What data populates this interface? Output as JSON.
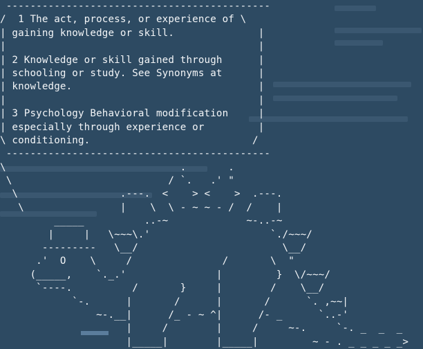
{
  "terminal": {
    "lines": [
      " -------------------------------------------- ",
      "/  1 The act, process, or experience of \\",
      "| gaining knowledge or skill.              |",
      "|                                          |",
      "| 2 Knowledge or skill gained through      |",
      "| schooling or study. See Synonyms at      |",
      "| knowledge.                               |",
      "|                                          |",
      "| 3 Psychology Behavioral modification     |",
      "| especially through experience or         |",
      "\\ conditioning.                           /",
      " -------------------------------------------- ",
      "\\                             .       .",
      " \\                          / `.   .' \"",
      "  \\                 .---.  <    > <    >  .---.",
      "   \\                |    \\  \\ - ~ ~ - /  /    |",
      "         _____          ..-~             ~-..-~",
      "        |     |   \\~~~\\.'                    `./~~~/",
      "       ---------   \\__/                        \\__/",
      "      .'  O    \\     /               /       \\  \"",
      "     (_____,    `._.'               |         }  \\/~~~/",
      "      `----.          /       }     |        /    \\__/",
      "            `-.      |       /      |       /      `. ,~~|",
      "                ~-.__|      /_ - ~ ^|      /- _      `..-'",
      "                     |     /        |     /     ~-.     `-. _  _  _",
      "                     |_____|        |_____|         ~ - . _ _ _ _ _>"
    ]
  }
}
